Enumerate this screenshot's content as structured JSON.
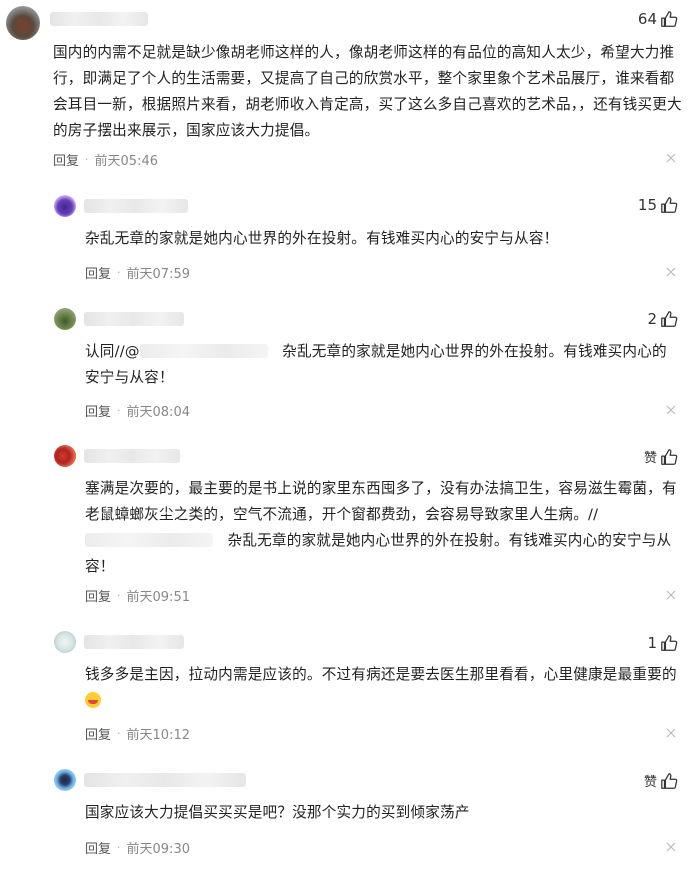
{
  "comments": [
    {
      "likes": "64",
      "text": "国内的内需不足就是缺少像胡老师这样的人，像胡老师这样的有品位的高知人太少，希望大力推行，即满足了个人的生活需要，又提高了自己的欣赏水平，整个家里象个艺术品展厅，谁来看都会耳目一新，根据照片来看，胡老师收入肯定高，买了这么多自己喜欢的艺术品，，还有钱买更大的房子摆出来展示，国家应该大力提倡。",
      "reply": "回复",
      "time": "前天05:46"
    },
    {
      "likes": "15",
      "text": "杂乱无章的家就是她内心世界的外在投射。有钱难买内心的安宁与从容！",
      "reply": "回复",
      "time": "前天07:59"
    },
    {
      "likes": "2",
      "prefix": "认同//@",
      "text": "杂乱无章的家就是她内心世界的外在投射。有钱难买内心的安宁与从容！",
      "reply": "回复",
      "time": "前天08:04"
    },
    {
      "likes": "赞",
      "text_before": "塞满是次要的，最主要的是书上说的家里东西囤多了，没有办法搞卫生，容易滋生霉菌，有老鼠蟑螂灰尘之类的，空气不流通，开个窗都费劲，会容易导致家里人生病。//",
      "text_after": "杂乱无章的家就是她内心世界的外在投射。有钱难买内心的安宁与从容！",
      "reply": "回复",
      "time": "前天09:51"
    },
    {
      "likes": "1",
      "text": "钱多多是主因，拉动内需是应该的。不过有病还是要去医生那里看看，心里健康是最重要的",
      "reply": "回复",
      "time": "前天10:12"
    },
    {
      "likes": "赞",
      "text": "国家应该大力提倡买买买是吧？没那个实力的买到倾家荡产",
      "reply": "回复",
      "time": "前天09:30"
    }
  ],
  "icons": {
    "like": "thumbs-up-icon",
    "close": "close-icon",
    "emoji": "laughing-emoji-icon"
  },
  "colors": {
    "text": "#222222",
    "meta": "#888888"
  }
}
